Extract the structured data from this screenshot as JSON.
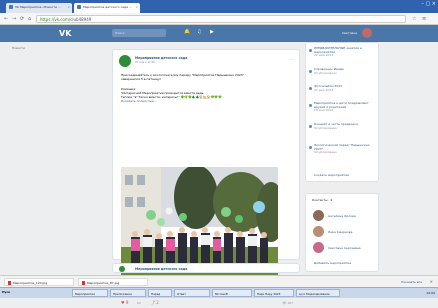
{
  "browser": {
    "tabs": [
      {
        "label": "VK Мероприятия «Новости …"
      },
      {
        "label": "Мероприятия детского сада …"
      }
    ],
    "url_secure": "https://vk.com",
    "url_rest": "/club48949"
  },
  "vk": {
    "logo": "VK",
    "search_placeholder": "Поиск",
    "username": "Светлана"
  },
  "left_nav": {
    "item": "Новости"
  },
  "post": {
    "community": "Мероприятия детского сада",
    "date": "20 мая в 12:00",
    "text_lines": [
      "Присоединяйтесь к экологическому параду \"Мероприятие Нарышкино 2023\"",
      "завершился 5 в пятницу!",
      "",
      "Ромашка:",
      "\"Интересной Мероприятия проводится вместе ведь",
      "Теплое \"в\" Тесно вместе, интересы!\" 🌳🌿🌳🌲🌲🏠🏡🏠💚💚💚",
      "Показать полностью..."
    ],
    "caption": "📍 Город Нарышкино",
    "likes": "9",
    "comments": "",
    "shares": "2",
    "views": "👁 167"
  },
  "post2": {
    "community": "Мероприятия детского сада"
  },
  "right_panel": {
    "items": [
      {
        "title": "ПРЕДВАРИТЕЛЬНЫЕ занятия и мероприятия",
        "date": "22 мая 2023"
      },
      {
        "title": "Справочник Ирада",
        "date": "Опубликовано"
      },
      {
        "title": "Фотоальбом 2023",
        "date": "22 мая 2023"
      },
      {
        "title": "Мероприятия и дети поздравляют друзей и родителей",
        "date": "10 мая 2023"
      },
      {
        "title": "Концерт в честь праздника",
        "date": "Опубликовано"
      },
      {
        "title": "Экологический парад \"Нарышкино 2023\"",
        "date": "Опубликовано"
      }
    ],
    "footer": "Создать мероприятие"
  },
  "friends_panel": {
    "title": "Контакты · 4",
    "people": [
      {
        "name": "Ангелина Орлова"
      },
      {
        "name": "Лера Смирнова"
      },
      {
        "name": "Светлана Сергеевна"
      }
    ],
    "add": "Добавить мероприятие"
  },
  "downloads": {
    "items": [
      {
        "name": "Мероприятие_120.jpg"
      },
      {
        "name": "Мероприятие_87.jpg"
      }
    ],
    "show_all": "Показать все"
  },
  "taskbar": {
    "start": "Пуск",
    "items": [
      {
        "label": "Мероприятия"
      },
      {
        "label": "Приложение"
      },
      {
        "label": "Парад"
      },
      {
        "label": "Ответ"
      },
      {
        "label": "Microsoft"
      },
      {
        "label": "Парк Перу 2023"
      },
      {
        "label": "Lync Моделирование"
      }
    ],
    "clock": "12:00"
  }
}
